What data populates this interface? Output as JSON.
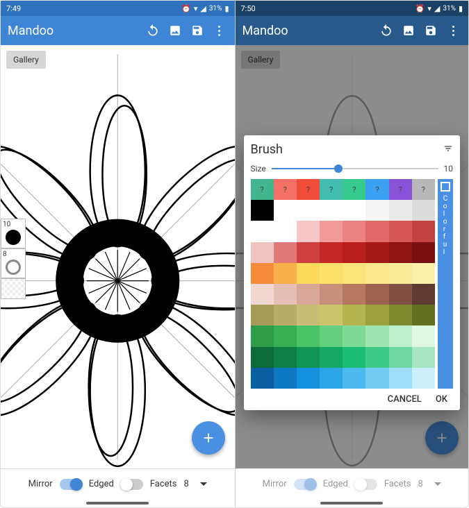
{
  "left": {
    "status": {
      "time": "7:49",
      "battery": "31%"
    },
    "appbar": {
      "title": "Mandoo"
    },
    "gallery_label": "Gallery",
    "tools": {
      "brush_size": "10",
      "eraser_size": "8"
    },
    "bottom": {
      "mirror_label": "Mirror",
      "mirror_on": true,
      "edged_label": "Edged",
      "edged_on": false,
      "facets_label": "Facets",
      "facets_value": "8"
    }
  },
  "right": {
    "status": {
      "time": "7:50",
      "battery": "31%"
    },
    "appbar": {
      "title": "Mandoo"
    },
    "gallery_label": "Gallery",
    "dialog": {
      "title": "Brush",
      "size_label": "Size",
      "size_value": "10",
      "colorful_label": "Colorful",
      "cancel_label": "CANCEL",
      "ok_label": "OK",
      "unknown_row": [
        "?",
        "?",
        "?",
        "?",
        "?",
        "?",
        "?",
        "?"
      ],
      "palette": [
        [
          "#43b58c",
          "#f27066",
          "#f24d3a",
          "#43bdb0",
          "#35c98e",
          "#3aa0ef",
          "#8a52d6",
          "#b8b8b8"
        ],
        [
          "#000000",
          "#ffffff",
          "#ffffff",
          "#ffffff",
          "#ffffff",
          "#f5f5f5",
          "#eaeaea",
          "#dcdcdc"
        ],
        [
          "#ffffff",
          "#ffffff",
          "#f7c6c6",
          "#f19a9a",
          "#eb8383",
          "#e36a6a",
          "#d45656",
          "#c24242"
        ],
        [
          "#f0c3c3",
          "#e07a7a",
          "#cf4040",
          "#c22626",
          "#b61d1d",
          "#a31818",
          "#8f1313",
          "#7a0f0f"
        ],
        [
          "#f48a3b",
          "#f7b24b",
          "#fbd95a",
          "#fbe06a",
          "#fbe47a",
          "#fbe88a",
          "#fbec9a",
          "#fcf0aa"
        ],
        [
          "#f0d7d0",
          "#e6c0b6",
          "#d8a898",
          "#c8907c",
          "#b87761",
          "#9e6350",
          "#805042",
          "#5f3a30"
        ],
        [
          "#a69a58",
          "#b8ac68",
          "#c9bd78",
          "#CBC46D",
          "#b3b54f",
          "#9aa13d",
          "#7f8a2e",
          "#636f20"
        ],
        [
          "#2e9c48",
          "#38af55",
          "#4bc368",
          "#63cf7f",
          "#7fda98",
          "#9ee5b2",
          "#bff0cd",
          "#dff8e6"
        ],
        [
          "#0d6a3a",
          "#0f7f47",
          "#129455",
          "#16a964",
          "#1abd73",
          "#3cc98a",
          "#6fd6a6",
          "#a7e5c5"
        ],
        [
          "#0a5fa3",
          "#0f78c2",
          "#1391df",
          "#2aa6e8",
          "#4cb9ee",
          "#74ccf3",
          "#a0def7",
          "#cdeffb"
        ]
      ]
    },
    "bottom": {
      "mirror_label": "Mirror",
      "mirror_on": true,
      "edged_label": "Edged",
      "edged_on": false,
      "facets_label": "Facets",
      "facets_value": "8"
    }
  }
}
